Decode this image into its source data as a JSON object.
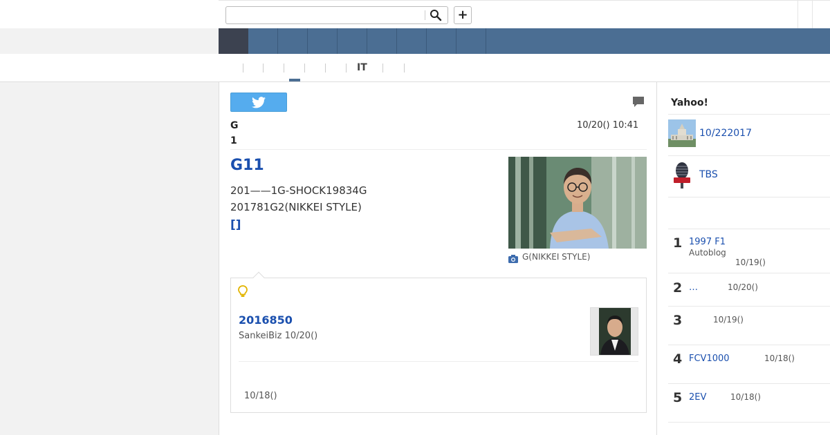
{
  "search": {
    "placeholder": "",
    "value": ""
  },
  "header": {
    "add_label": "+"
  },
  "subnav": {
    "it_label": "IT"
  },
  "article": {
    "source_line1": "G",
    "source_line2": "1",
    "datetime": "10/20() 10:41",
    "headline": "G11",
    "body_line1": "201——1G-SHOCK19834G",
    "body_line2": "201781G2(NIKKEI STYLE)",
    "more_link": "[]",
    "photo_caption": "G(NIKKEI STYLE)"
  },
  "related": {
    "title": "2016850",
    "meta": "SankeiBiz 10/20()",
    "second_date": "10/18()"
  },
  "sidebar": {
    "heading": "Yahoo!",
    "topics": [
      {
        "label": "10/222017",
        "icon": "diet-building-thumbnail"
      },
      {
        "label": "TBS",
        "icon": "news-microphone-thumbnail"
      }
    ],
    "ranking": [
      {
        "rank": "1",
        "title": "1997 F1",
        "source": "Autoblog",
        "date": "10/19()"
      },
      {
        "rank": "2",
        "title": "…",
        "source": "",
        "date": "10/20()"
      },
      {
        "rank": "3",
        "title": "",
        "source": "",
        "date": "10/19()"
      },
      {
        "rank": "4",
        "title": "FCV1000",
        "source": "",
        "date": "10/18()"
      },
      {
        "rank": "5",
        "title": "2EV",
        "source": "",
        "date": "10/18()"
      }
    ]
  },
  "colors": {
    "nav_bar": "#4b6e93",
    "nav_home": "#3c4250",
    "link_blue": "#1a4fae",
    "twitter_blue": "#55acee"
  }
}
